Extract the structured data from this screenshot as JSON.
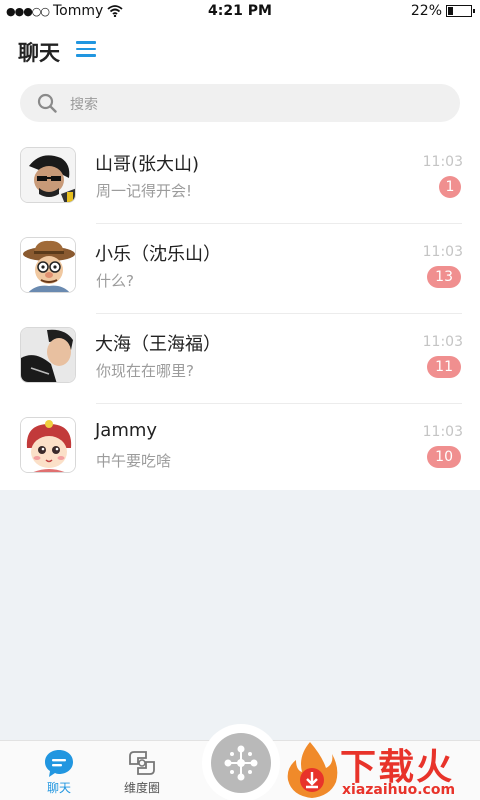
{
  "status_bar": {
    "signal": "●●●○○",
    "carrier": "Tommy",
    "time": "4:21 PM",
    "battery_text": "22%",
    "battery_level": 0.22
  },
  "header": {
    "title": "聊天"
  },
  "search": {
    "placeholder": "搜索"
  },
  "chats": [
    {
      "name": "山哥(张大山)",
      "message": "周一记得开会!",
      "time": "11:03",
      "unread": "1"
    },
    {
      "name": "小乐（沈乐山）",
      "message": "什么?",
      "time": "11:03",
      "unread": "13"
    },
    {
      "name": "大海（王海福）",
      "message": "你现在在哪里?",
      "time": "11:03",
      "unread": "11"
    },
    {
      "name": "Jammy",
      "message": "中午要吃啥",
      "time": "11:03",
      "unread": "10"
    }
  ],
  "tabs": [
    {
      "label": "聊天",
      "icon": "chat-bubble-icon",
      "active": true
    },
    {
      "label": "维度圈",
      "icon": "circle-dimension-icon",
      "active": false
    }
  ],
  "center_button": {
    "icon": "network-nodes-icon"
  },
  "watermark": {
    "brand": "下载火",
    "url": "xiazaihuo.com"
  },
  "colors": {
    "accent": "#2196e0",
    "badge": "#f08f8f",
    "watermark": "#e8332a"
  }
}
